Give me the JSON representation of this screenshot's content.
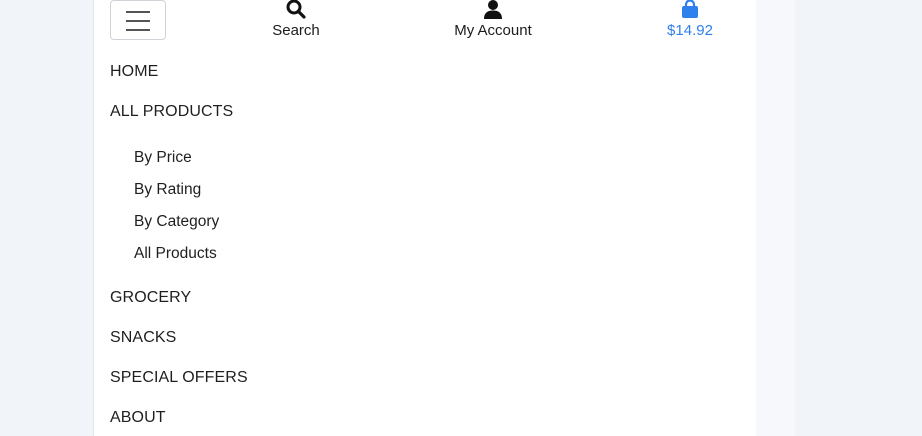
{
  "header": {
    "search_label": "Search",
    "account_label": "My Account",
    "cart_total": "$14.92",
    "accent_color": "#2f80ed",
    "icons": [
      "menu-icon",
      "search-icon",
      "user-icon",
      "shopping-bag-icon"
    ]
  },
  "menu": {
    "items": [
      {
        "label": "HOME"
      },
      {
        "label": "ALL PRODUCTS"
      },
      {
        "label": "GROCERY"
      },
      {
        "label": "SNACKS"
      },
      {
        "label": "SPECIAL OFFERS"
      },
      {
        "label": "ABOUT"
      }
    ],
    "submenu": [
      {
        "label": "By Price"
      },
      {
        "label": "By Rating"
      },
      {
        "label": "By Category"
      },
      {
        "label": "All Products"
      }
    ]
  }
}
